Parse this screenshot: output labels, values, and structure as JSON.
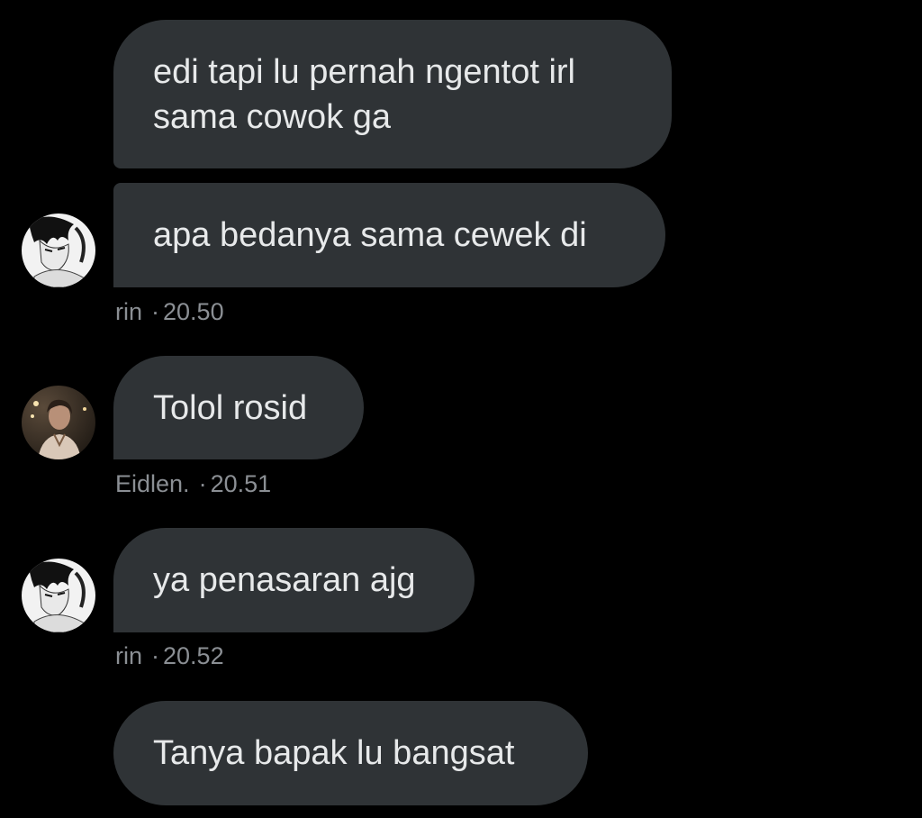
{
  "messages": [
    {
      "text": "edi tapi lu pernah ngentot irl\nsama cowok ga"
    },
    {
      "text": "apa bedanya sama cewek di"
    },
    {
      "text": "Tolol rosid"
    },
    {
      "text": "ya penasaran ajg"
    },
    {
      "text": "Tanya bapak lu bangsat"
    }
  ],
  "meta": [
    {
      "sender": "rin",
      "time": "20.50"
    },
    {
      "sender": "Eidlen.",
      "time": "20.51"
    },
    {
      "sender": "rin",
      "time": "20.52"
    }
  ],
  "separator": "·",
  "avatars": {
    "rin": "anime-boy-avatar",
    "eidlen": "photo-avatar"
  },
  "colors": {
    "background": "#000000",
    "bubble": "#2f3336",
    "bubble_text": "#e7e9ea",
    "meta_text": "#8b8f94"
  }
}
